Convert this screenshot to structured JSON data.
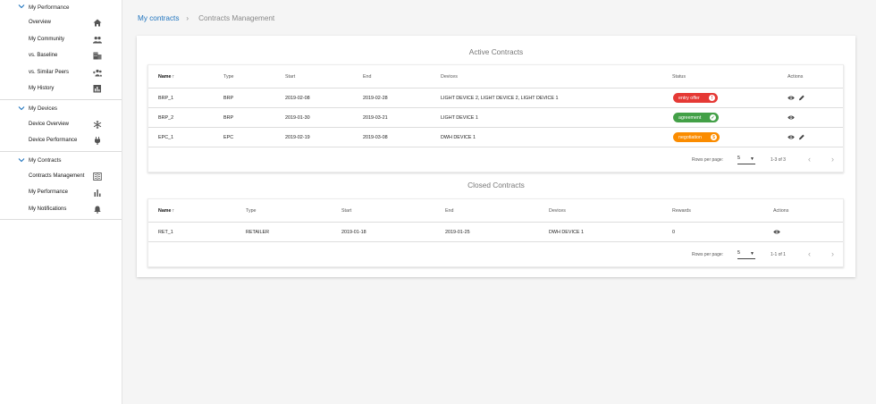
{
  "sidebar": {
    "sections": [
      {
        "title": "My Performance",
        "items": [
          {
            "label": "Overview",
            "icon": "home-icon"
          },
          {
            "label": "My Community",
            "icon": "people-icon"
          },
          {
            "label": "vs. Baseline",
            "icon": "building-icon"
          },
          {
            "label": "vs. Similar Peers",
            "icon": "group-add-icon"
          },
          {
            "label": "My History",
            "icon": "assessment-icon"
          }
        ]
      },
      {
        "title": "My Devices",
        "items": [
          {
            "label": "Device Overview",
            "icon": "snowflake-icon"
          },
          {
            "label": "Device Performance",
            "icon": "plug-icon"
          }
        ]
      },
      {
        "title": "My Contracts",
        "items": [
          {
            "label": "Contracts Management",
            "icon": "contracts-list-icon"
          },
          {
            "label": "My Performance",
            "icon": "bar-chart-icon"
          },
          {
            "label": "My Notifications",
            "icon": "bell-icon"
          }
        ]
      }
    ]
  },
  "breadcrumb": {
    "link": "My contracts",
    "separator": "›",
    "current": "Contracts Management"
  },
  "active": {
    "title": "Active Contracts",
    "headers": {
      "name": "Name",
      "type": "Type",
      "start": "Start",
      "end": "End",
      "devices": "Devices",
      "status": "Status",
      "actions": "Actions"
    },
    "rows": [
      {
        "name": "BRP_1",
        "type": "BRP",
        "start": "2019-02-08",
        "end": "2019-02-28",
        "devices": "LIGHT DEVICE 2, LIGHT DEVICE 2, LIGHT DEVICE 1",
        "status": "entry offer",
        "status_color": "#e53935",
        "status_icon": "!"
      },
      {
        "name": "BRP_2",
        "type": "BRP",
        "start": "2019-01-30",
        "end": "2019-03-21",
        "devices": "LIGHT DEVICE 1",
        "status": "agreement",
        "status_color": "#43a047",
        "status_icon": "✓"
      },
      {
        "name": "EPC_1",
        "type": "EPC",
        "start": "2019-02-19",
        "end": "2019-03-08",
        "devices": "DWH DEVICE 1",
        "status": "negotiation",
        "status_color": "#fb8c00",
        "status_icon": "$"
      }
    ],
    "pager": {
      "rows_label": "Rows per page:",
      "rows_value": "5",
      "range": "1-3 of 3"
    }
  },
  "closed": {
    "title": "Closed Contracts",
    "headers": {
      "name": "Name",
      "type": "Type",
      "start": "Start",
      "end": "End",
      "devices": "Devices",
      "rewards": "Rewards",
      "actions": "Actions"
    },
    "rows": [
      {
        "name": "RET_1",
        "type": "RETAILER",
        "start": "2019-01-18",
        "end": "2019-01-25",
        "devices": "DWH DEVICE 1",
        "rewards": "0"
      }
    ],
    "pager": {
      "rows_label": "Rows per page:",
      "rows_value": "5",
      "range": "1-1 of 1"
    }
  },
  "nav_icons": {
    "prev": "‹",
    "next": "›",
    "caret": "▼",
    "sort": "↑",
    "chevron": "⌄"
  }
}
